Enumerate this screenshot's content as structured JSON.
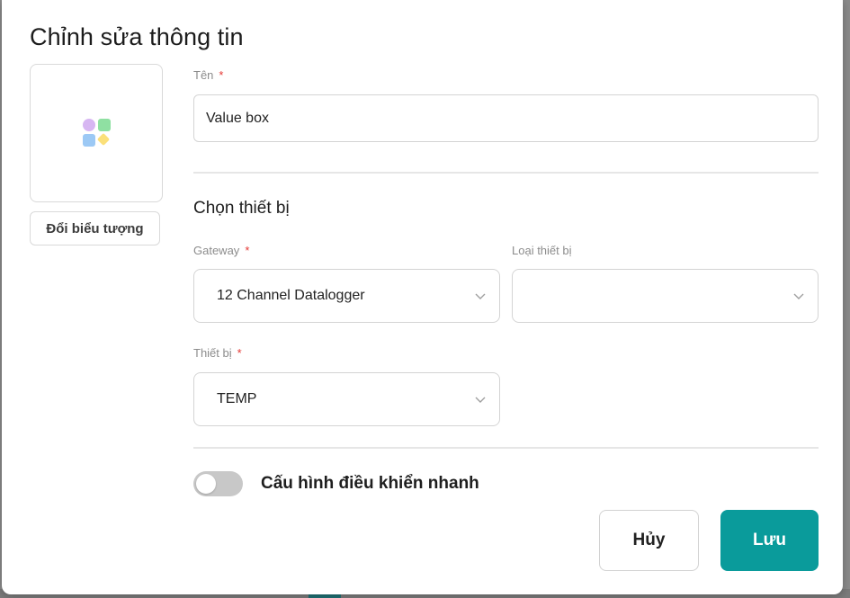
{
  "dialog": {
    "title": "Chỉnh sửa thông tin"
  },
  "icon_panel": {
    "icon_name": "widget-grid-icon",
    "change_button_label": "Đổi biểu tượng"
  },
  "name_field": {
    "label": "Tên",
    "required_mark": "*",
    "value": "Value box"
  },
  "device_section": {
    "title": "Chọn thiết bị",
    "gateway": {
      "label": "Gateway",
      "required_mark": "*",
      "selected": "12 Channel Datalogger"
    },
    "device_type": {
      "label": "Loại thiết bị",
      "selected": ""
    },
    "device": {
      "label": "Thiết bị",
      "required_mark": "*",
      "selected": "TEMP"
    }
  },
  "quick_control": {
    "label": "Cấu hình điều khiển nhanh",
    "enabled": false
  },
  "footer": {
    "cancel_label": "Hủy",
    "save_label": "Lưu"
  },
  "colors": {
    "accent": "#0a9b9b",
    "required": "#e53935",
    "toggle_off": "#c8c8c8"
  }
}
